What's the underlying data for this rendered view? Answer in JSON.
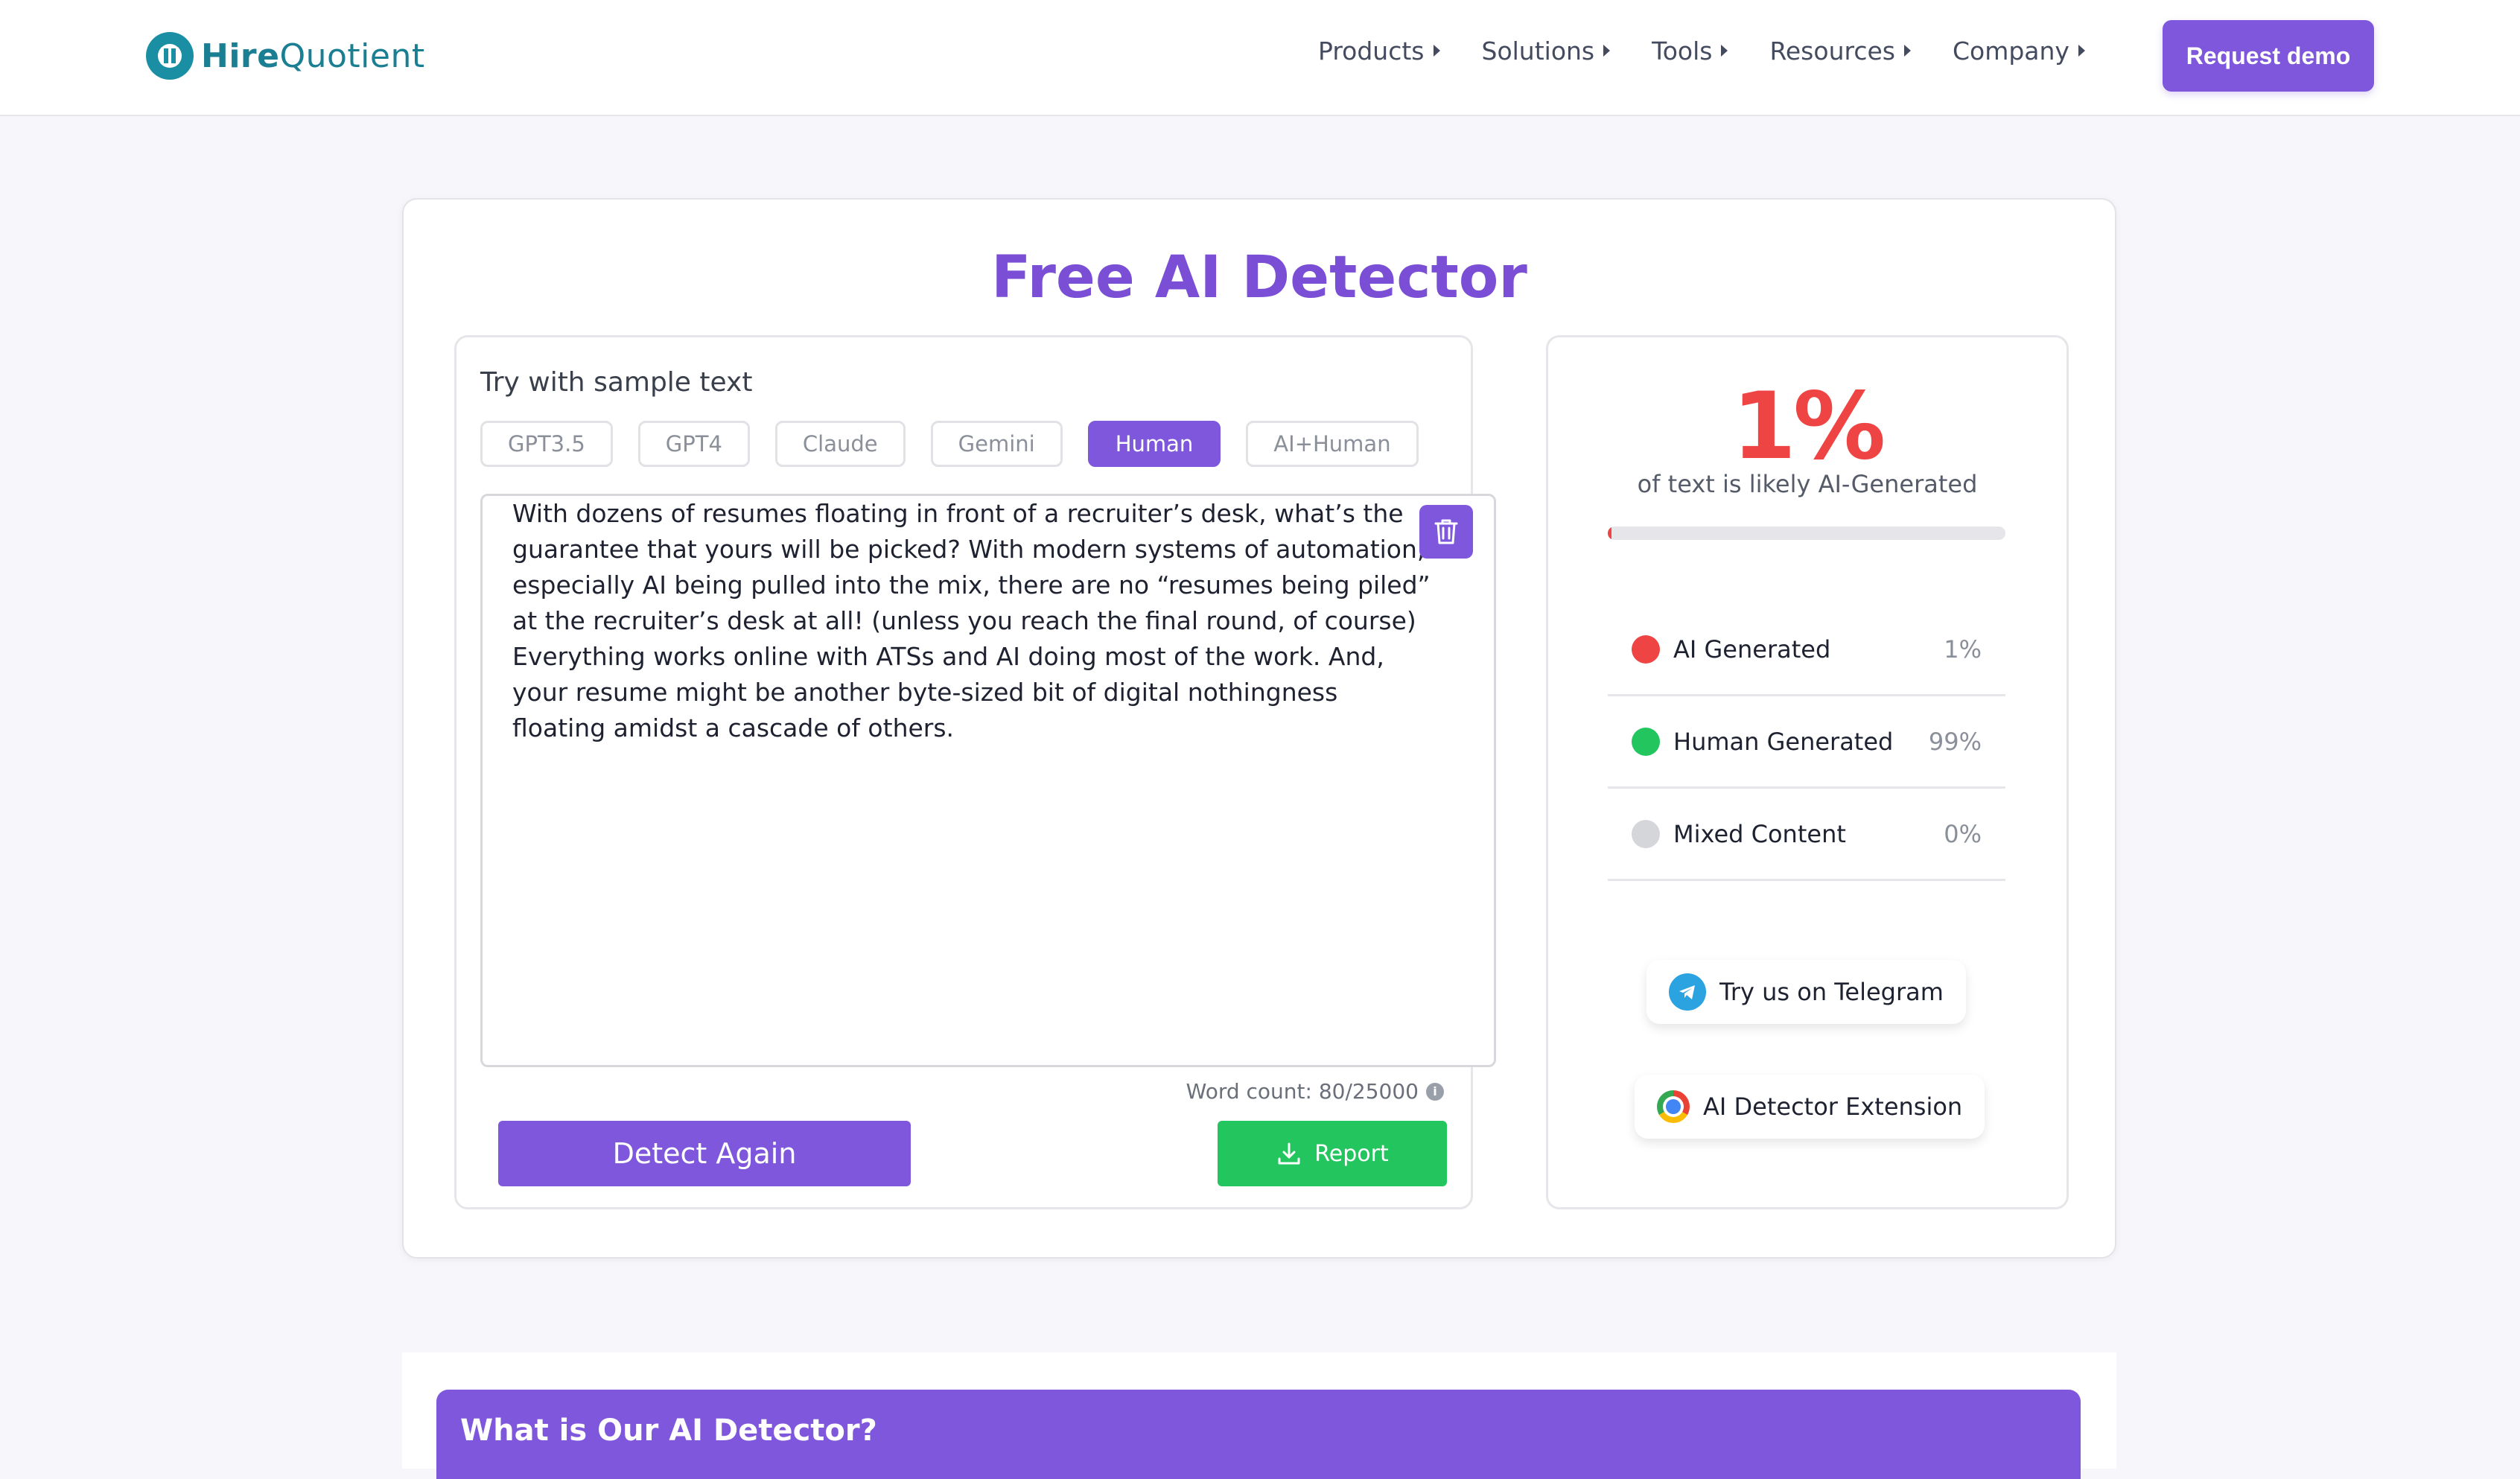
{
  "brand": {
    "name_bold": "Hire",
    "name_light": "Quotient"
  },
  "nav": [
    {
      "label": "Products"
    },
    {
      "label": "Solutions"
    },
    {
      "label": "Tools"
    },
    {
      "label": "Resources"
    },
    {
      "label": "Company"
    }
  ],
  "header": {
    "demo_label": "Request demo"
  },
  "detector": {
    "title": "Free AI Detector",
    "sample_label": "Try with sample text",
    "chips": [
      {
        "label": "GPT3.5",
        "active": false
      },
      {
        "label": "GPT4",
        "active": false
      },
      {
        "label": "Claude",
        "active": false
      },
      {
        "label": "Gemini",
        "active": false
      },
      {
        "label": "Human",
        "active": true
      },
      {
        "label": "AI+Human",
        "active": false
      }
    ],
    "text": "With dozens of resumes floating in front of a recruiter’s desk, what’s the guarantee that yours will be picked? With modern systems of automation, especially AI being pulled into the mix, there are no “resumes being piled” at the recruiter’s desk at all! (unless you reach the final round, of course) Everything works online with ATSs and AI doing most of the work. And, your resume might be another byte-sized bit of digital nothingness floating amidst a cascade of others.",
    "word_count": "Word count: 80/25000",
    "detect_label": "Detect Again",
    "report_label": "Report"
  },
  "result": {
    "percent": "1%",
    "percent_value": 1,
    "subtitle": "of text is likely AI-Generated",
    "stats": [
      {
        "label": "AI Generated",
        "value": "1%",
        "color": "#ef4444"
      },
      {
        "label": "Human Generated",
        "value": "99%",
        "color": "#22c55e"
      },
      {
        "label": "Mixed Content",
        "value": "0%",
        "color": "#d5d6da"
      }
    ],
    "telegram_label": "Try us on Telegram",
    "extension_label": "AI Detector Extension"
  },
  "faq": {
    "title": "What is Our AI Detector?"
  },
  "colors": {
    "brand": "#7e57dc",
    "danger": "#ef4444",
    "success": "#22c55e"
  }
}
